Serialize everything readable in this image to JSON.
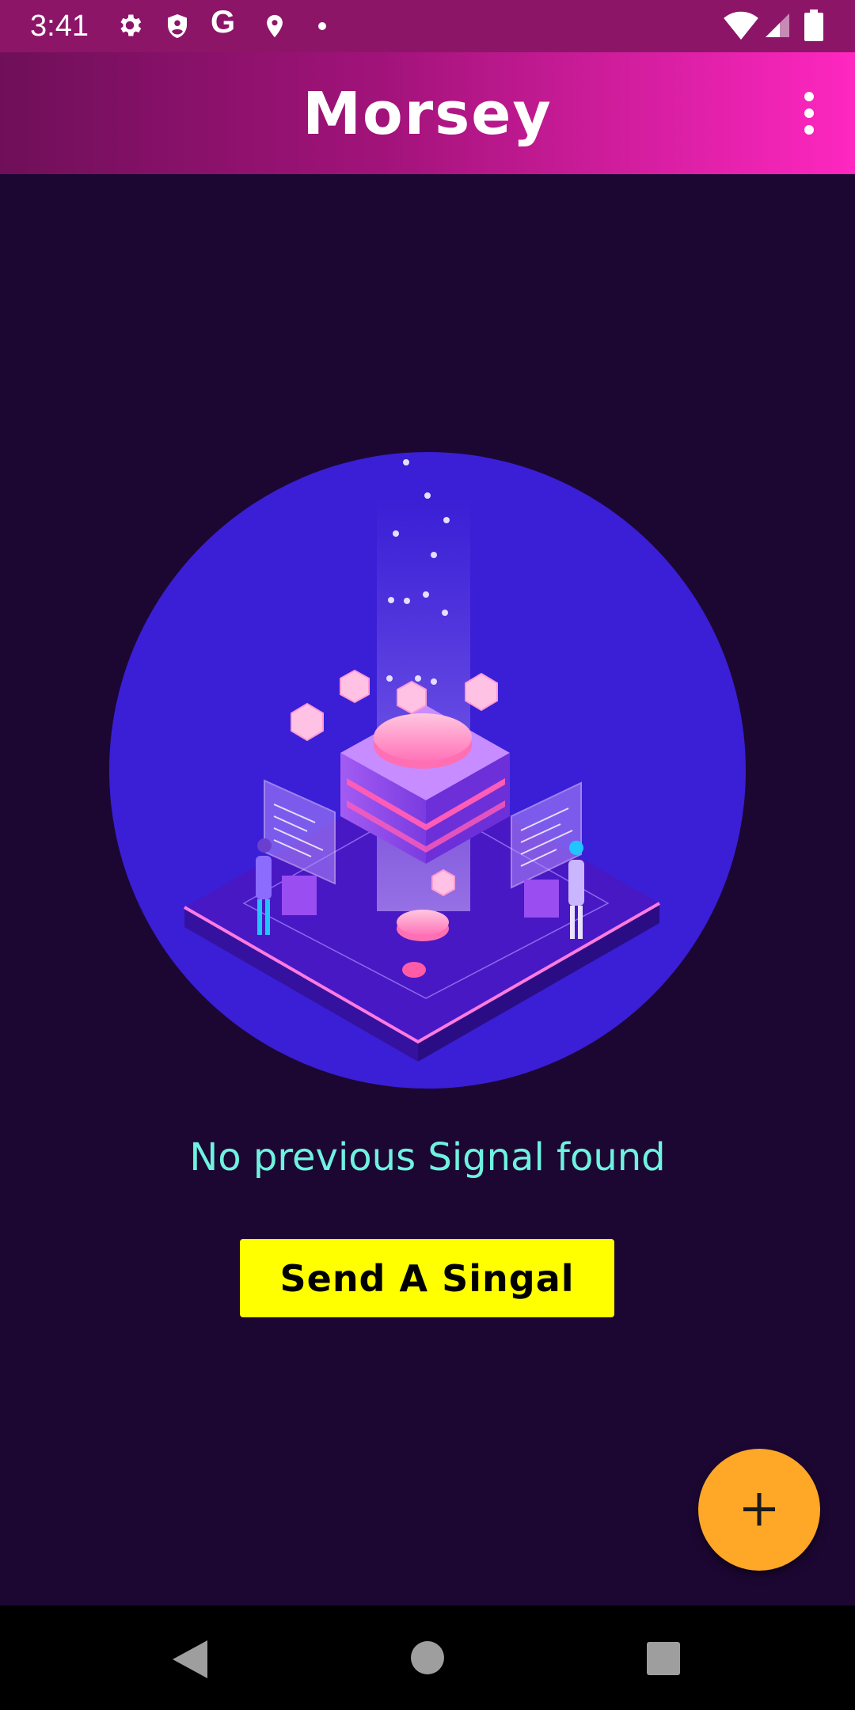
{
  "status_bar": {
    "time": "3:41",
    "left_icons": [
      "gear-icon",
      "shield-icon",
      "google-icon",
      "location-pin-icon",
      "dot-icon"
    ],
    "right_icons": [
      "wifi-icon",
      "signal-icon",
      "battery-icon"
    ],
    "google_glyph": "G"
  },
  "app_bar": {
    "title": "Morsey",
    "menu_icon": "more-vert-icon"
  },
  "main": {
    "illustration": "isometric-server-illustration",
    "empty_message": "No previous Signal found",
    "send_button_label": "Send A Singal"
  },
  "fab": {
    "icon": "plus-icon"
  },
  "nav_bar": {
    "icons": [
      "back-icon",
      "home-icon",
      "recents-icon"
    ]
  },
  "colors": {
    "background": "#1c0733",
    "accent_text": "#6ff2e0",
    "button": "#ffff00",
    "fab": "#ffa726",
    "circle": "#3a1fd6"
  }
}
